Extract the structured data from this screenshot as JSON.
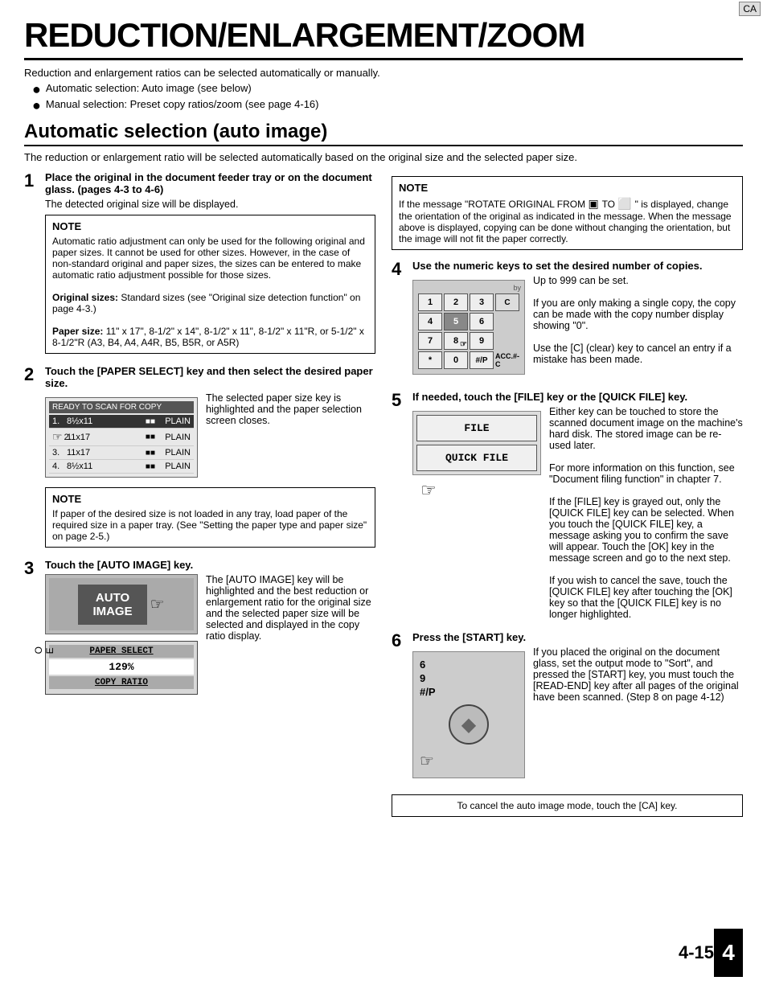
{
  "page": {
    "title": "REDUCTION/ENLARGEMENT/ZOOM",
    "intro": "Reduction and enlargement ratios can be selected automatically or manually.",
    "bullets": [
      "Automatic selection: Auto image (see below)",
      "Manual selection: Preset copy ratios/zoom (see page 4-16)"
    ],
    "section_title": "Automatic selection (auto image)",
    "section_desc": "The reduction or enlargement ratio will be selected automatically based on the original size and the selected paper size.",
    "step1": {
      "num": "1",
      "title": "Place the original in the document feeder tray or on the document glass. (pages 4-3 to 4-6)",
      "desc": "The detected original size will be displayed.",
      "note_title": "NOTE",
      "note_text": "Automatic ratio adjustment can only be used for the following original and paper sizes. It cannot be used for other sizes. However, in the case of non-standard original and paper sizes, the sizes can be entered to make automatic ratio adjustment possible for those sizes.",
      "original_label": "Original sizes:",
      "original_val": "Standard sizes (see \"Original size detection function\" on page 4-3.)",
      "paper_label": "Paper size:",
      "paper_val": "11\" x 17\", 8-1/2\" x 14\", 8-1/2\" x 11\", 8-1/2\" x 11\"R, or 5-1/2\" x 8-1/2\"R (A3, B4, A4, A4R, B5, B5R, or A5R)"
    },
    "step2": {
      "num": "2",
      "title": "Touch the [PAPER SELECT] key and then select the desired paper size.",
      "desc_right": "The selected paper size key is highlighted and the paper selection screen closes.",
      "note_title": "NOTE",
      "note_text": "If paper of the desired size is not loaded in any tray, load paper of the required size in a paper tray. (See \"Setting the paper type and paper size\" on page 2-5.)",
      "screen_header": "READY TO SCAN FOR COPY",
      "screen_items": [
        {
          "num": "1.",
          "size": "8½x11",
          "type": "PLAIN",
          "highlighted": true
        },
        {
          "num": "2.",
          "size": "11x17",
          "type": "PLAIN",
          "highlighted": false
        },
        {
          "num": "3.",
          "size": "11x17",
          "type": "PLAIN",
          "highlighted": false
        },
        {
          "num": "4.",
          "size": "8½x11",
          "type": "PLAIN",
          "highlighted": false
        }
      ]
    },
    "step3": {
      "num": "3",
      "title": "Touch the [AUTO IMAGE] key.",
      "auto_image_label": "AUTO IMAGE",
      "paper_select_label": "PAPER SELECT",
      "copy_ratio_label": "COPY RATIO",
      "ratio_value": "129%",
      "desc": "The [AUTO IMAGE] key will be highlighted and the best reduction or enlargement ratio for the original size and the selected paper size will be selected and displayed in the copy ratio display."
    },
    "note_right": {
      "note_title": "NOTE",
      "note_text": "If the message \"ROTATE ORIGINAL FROM",
      "note_text2": "\" is displayed, change the orientation of the original as indicated in the message. When the message above is displayed, copying can be done without changing the orientation, but the image will not fit the paper correctly."
    },
    "step4": {
      "num": "4",
      "title": "Use the numeric keys to set the desired number of copies.",
      "desc": "Up to 999 can be set.",
      "desc2": "If you are only making a single copy, the copy can be made with the copy number display showing \"0\".",
      "desc3": "Use the [C] (clear) key to cancel an entry if a mistake has been made.",
      "keys": [
        [
          "1",
          "2",
          "3",
          "C"
        ],
        [
          "4",
          "5",
          "6",
          ""
        ],
        [
          "7",
          "8",
          "9",
          ""
        ],
        [
          "*",
          "0",
          "#/P",
          ""
        ]
      ]
    },
    "step5": {
      "num": "5",
      "title": "If needed, touch the [FILE] key or the [QUICK FILE] key.",
      "file_label": "FILE",
      "quick_file_label": "QUICK FILE",
      "desc": "Either key can be touched to store the scanned document image on the machine's hard disk. The stored image can be re-used later.",
      "desc2": "For more information on this function, see \"Document filing function\" in chapter 7.",
      "desc3": "If the [FILE] key is grayed out, only the [QUICK FILE] key can be selected. When you touch the [QUICK FILE] key, a message asking you to confirm the save will appear. Touch the [OK] key in the message screen and go to the next step.",
      "desc4": "If you wish to cancel the save, touch the [QUICK FILE] key after touching the [OK] key so that the [QUICK FILE] key is no longer highlighted."
    },
    "step6": {
      "num": "6",
      "title": "Press the [START] key.",
      "labels": [
        "6",
        "9",
        "#/P"
      ],
      "desc": "If you placed the original on the document glass, set the output mode to \"Sort\", and pressed the [START] key, you must touch the [READ-END] key after all pages of the original have been scanned. (Step 8 on page 4-12)"
    },
    "cancel_bar": "To cancel the auto image mode, touch the [CA] key.",
    "page_num": "4-15",
    "chapter_num": "4"
  }
}
